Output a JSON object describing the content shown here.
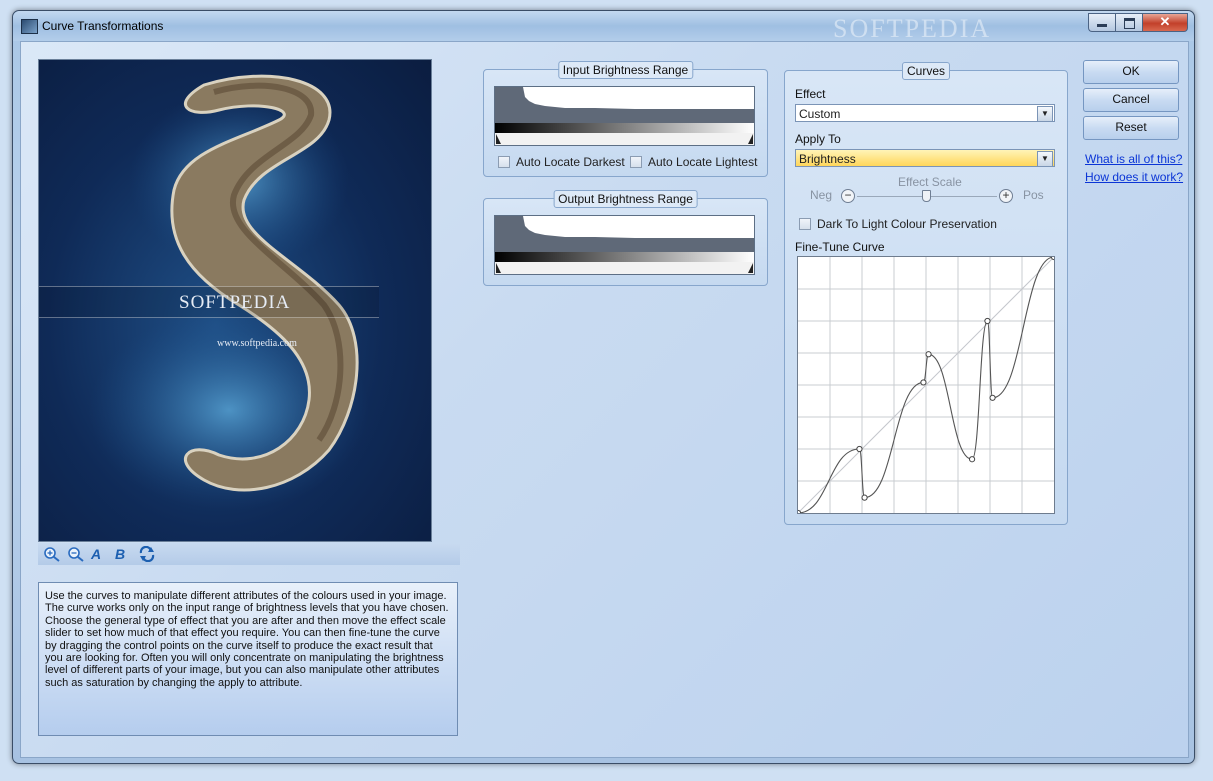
{
  "window": {
    "title": "Curve Transformations",
    "title_watermark": "SOFTPEDIA"
  },
  "preview": {
    "watermark_title": "SOFTPEDIA",
    "watermark_url": "www.softpedia.com"
  },
  "toolbar": {
    "letter_a": "A",
    "letter_b": "B"
  },
  "help_text": "Use the curves to manipulate different attributes of the colours used in your image. The curve works only on the input range of brightness levels that you have chosen. Choose the general type of effect that you are after and then move the effect scale slider to set how much of that effect you require. You can then fine-tune the curve by dragging the control points on the curve itself to produce the exact result that you are looking for. Often you will only concentrate on manipulating the brightness level of different parts of your image, but you can also manipulate other attributes such as saturation by changing the apply to attribute.",
  "input_range": {
    "title": "Input Brightness Range",
    "auto_darkest": "Auto Locate Darkest",
    "auto_lightest": "Auto Locate Lightest"
  },
  "output_range": {
    "title": "Output Brightness Range"
  },
  "curves": {
    "title": "Curves",
    "effect_label": "Effect",
    "effect_value": "Custom",
    "apply_label": "Apply To",
    "apply_value": "Brightness",
    "scale_label": "Effect Scale",
    "neg_label": "Neg",
    "pos_label": "Pos",
    "preservation_label": "Dark To Light Colour Preservation",
    "finetune_label": "Fine-Tune Curve",
    "control_points": [
      {
        "x": 0.24,
        "y": 0.25
      },
      {
        "x": 0.26,
        "y": 0.06
      },
      {
        "x": 0.49,
        "y": 0.51
      },
      {
        "x": 0.51,
        "y": 0.62
      },
      {
        "x": 0.68,
        "y": 0.21
      },
      {
        "x": 0.74,
        "y": 0.75
      },
      {
        "x": 0.76,
        "y": 0.45
      },
      {
        "x": 1.0,
        "y": 1.0
      }
    ]
  },
  "buttons": {
    "ok": "OK",
    "cancel": "Cancel",
    "reset": "Reset",
    "what_link": "What is all of this?",
    "how_link": "How does it work?"
  },
  "colors": {
    "accent": "#1c5fb0",
    "link": "#0b35d6",
    "histogram": "#5f6978"
  }
}
